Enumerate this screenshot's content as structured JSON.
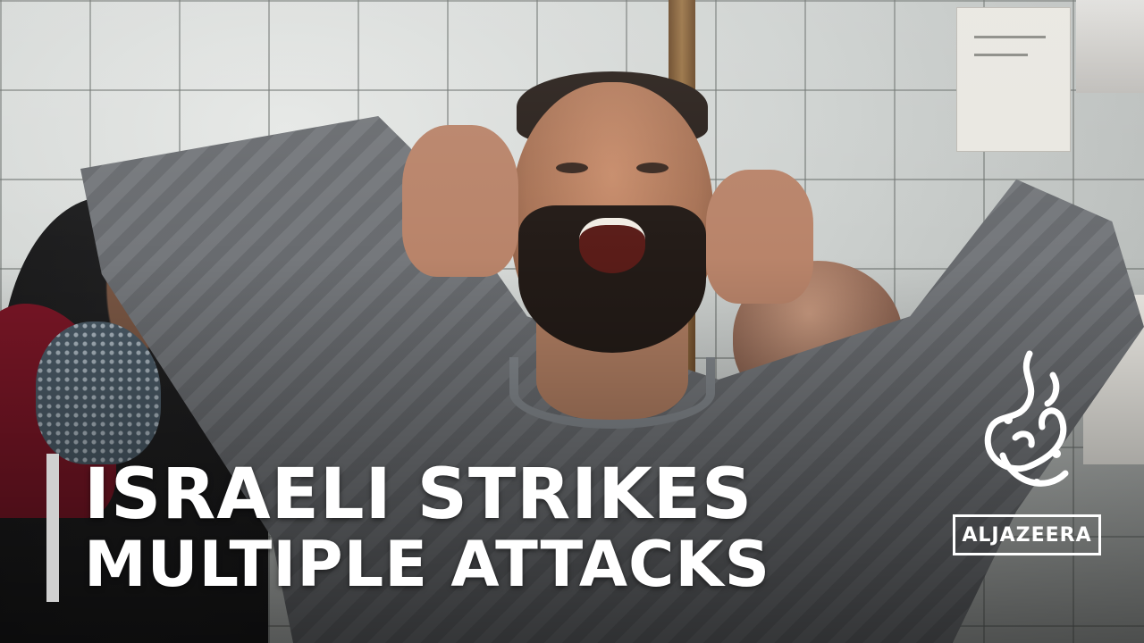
{
  "headline": {
    "line1": "ISRAELI STRIKES",
    "line2": "MULTIPLE ATTACKS"
  },
  "logo": {
    "wordmark": "ALJAZEERA",
    "icon": "aljazeera-calligraphy-logo"
  },
  "colors": {
    "headline_text": "#ffffff",
    "accent_bar": "#d0d0d0"
  }
}
